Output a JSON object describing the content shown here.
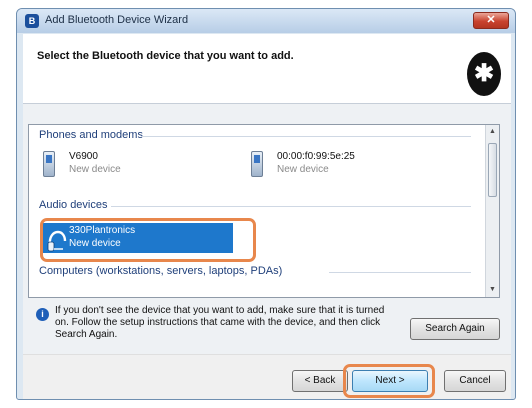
{
  "window": {
    "title": "Add Bluetooth Device Wizard",
    "title_icon_glyph": "B",
    "close_glyph": "✕"
  },
  "header": {
    "title": "Select the Bluetooth device that you want to add.",
    "logo_glyph": "✱"
  },
  "groups": {
    "phones": "Phones and modems",
    "audio": "Audio devices",
    "computers": "Computers (workstations, servers, laptops, PDAs)"
  },
  "devices": {
    "phone1": {
      "name": "V6900",
      "status": "New device",
      "icon": "phone-icon"
    },
    "phone2": {
      "name": "00:00:f0:99:5e:25",
      "status": "New device",
      "icon": "phone-icon"
    },
    "audio1": {
      "name": "330Plantronics",
      "status": "New device",
      "icon": "headset-icon",
      "selected": true
    }
  },
  "info": {
    "text": "If you don't see the device that you want to add, make sure that it is turned on. Follow the setup instructions that came with the device, and then click Search Again."
  },
  "buttons": {
    "search_again": "Search Again",
    "back": "< Back",
    "next": "Next >",
    "cancel": "Cancel"
  },
  "colors": {
    "highlight": "#e8874c",
    "selection": "#1e78cc"
  }
}
